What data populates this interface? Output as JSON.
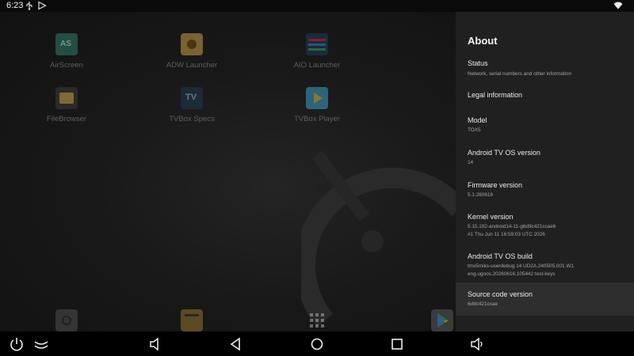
{
  "status_bar": {
    "time": "6:23",
    "left_icons": [
      "usb-icon",
      "play-store-notification-icon"
    ],
    "right_icons": [
      "wifi-icon"
    ]
  },
  "launcher": {
    "apps": [
      {
        "label": "AirScreen",
        "icon": "airscreen-icon",
        "color": "#2e7d6a"
      },
      {
        "label": "ADW Launcher",
        "icon": "adw-launcher-icon",
        "color": "#c9a14a"
      },
      {
        "label": "AIO Launcher",
        "icon": "aio-launcher-icon",
        "color": "#2a6fa8"
      },
      {
        "label": "FileBrowser",
        "icon": "filebrowser-icon",
        "color": "#d5b04a"
      },
      {
        "label": "TVBox Specs",
        "icon": "tvbox-specs-icon",
        "color": "#1e3a4f"
      },
      {
        "label": "TVBox Player",
        "icon": "tvbox-player-icon",
        "color": "#3fa0c9"
      }
    ],
    "dock": [
      "settings-icon",
      "file-manager-icon",
      "app-drawer-icon",
      "play-store-icon"
    ]
  },
  "about": {
    "title": "About",
    "items": [
      {
        "title": "Status",
        "subtitle": [
          "Network, serial numbers and other information"
        ]
      },
      {
        "title": "Legal information",
        "subtitle": []
      },
      {
        "title": "Model",
        "subtitle": [
          "TOX5"
        ]
      },
      {
        "title": "Android TV OS version",
        "subtitle": [
          "14"
        ]
      },
      {
        "title": "Firmware version",
        "subtitle": [
          "5.1.260616"
        ]
      },
      {
        "title": "Kernel version",
        "subtitle": [
          "5.15.192-android14-11-g6d9c421ccae6",
          "#1 Thu Jun 11 16:59:03 UTC 2026"
        ]
      },
      {
        "title": "Android TV OS build",
        "subtitle": [
          "tmx5miks-userdebug 14 UD2A.240505.001.W1",
          "eng.ugoos.20260616.105442 test-keys"
        ]
      },
      {
        "title": "Source code version",
        "subtitle": [
          "6d9c421ccae"
        ],
        "selected": true
      }
    ]
  },
  "nav_bar": [
    "power-icon",
    "collapse-icon",
    "volume-down-icon",
    "back-icon",
    "home-icon",
    "recents-icon",
    "volume-up-icon"
  ],
  "colors": {
    "panel_bg": "#202020",
    "selected_bg": "#2e2e2e",
    "launcher_bg": "#151515"
  }
}
